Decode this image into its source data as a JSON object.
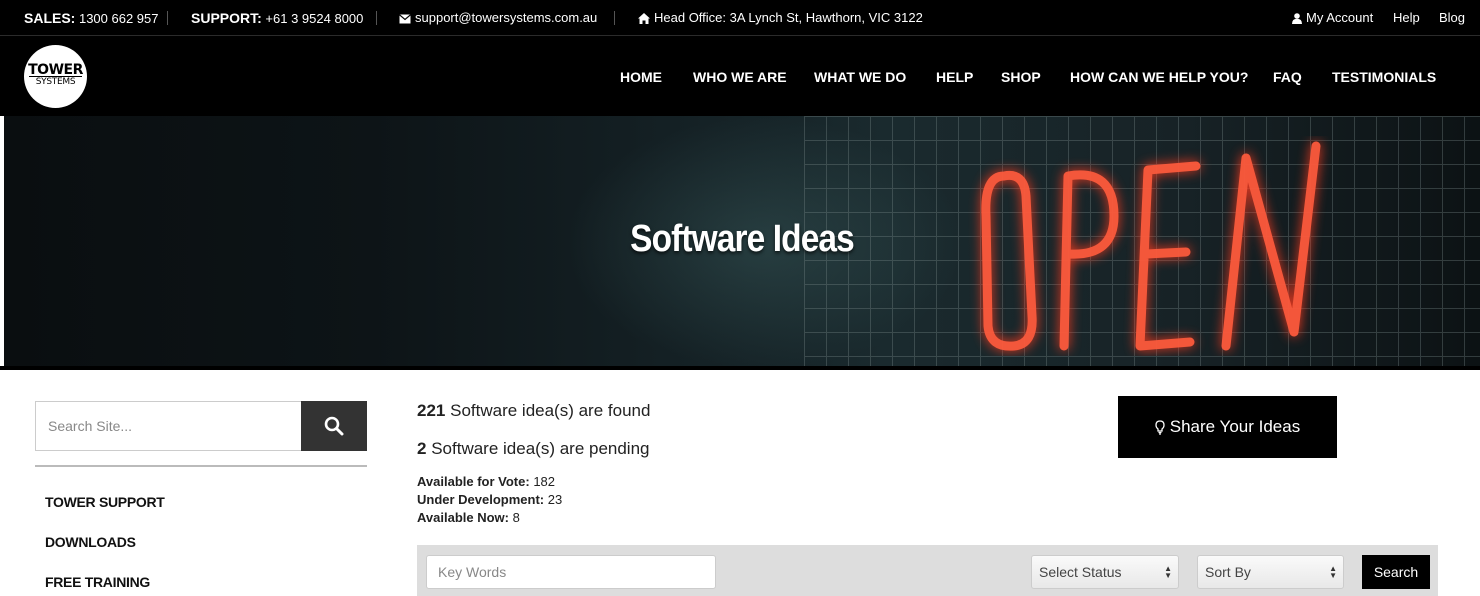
{
  "topbar": {
    "sales_label": "SALES:",
    "sales_phone": "1300 662 957",
    "support_label": "SUPPORT:",
    "support_phone": "+61 3 9524 8000",
    "email": "support@towersystems.com.au",
    "head_office": "Head Office: 3A Lynch St, Hawthorn, VIC 3122",
    "my_account": "My Account",
    "help": "Help",
    "blog": "Blog"
  },
  "logo": {
    "line1": "TOWER",
    "line2": "SYSTEMS"
  },
  "nav": {
    "items": [
      {
        "label": "HOME"
      },
      {
        "label": "WHO WE ARE"
      },
      {
        "label": "WHAT WE DO"
      },
      {
        "label": "HELP"
      },
      {
        "label": "SHOP"
      },
      {
        "label": "HOW CAN WE HELP YOU?"
      },
      {
        "label": "FAQ"
      },
      {
        "label": "TESTIMONIALS"
      }
    ]
  },
  "hero": {
    "title": "Software Ideas"
  },
  "sidebar": {
    "search_placeholder": "Search Site...",
    "links": [
      {
        "label": "TOWER SUPPORT"
      },
      {
        "label": "DOWNLOADS"
      },
      {
        "label": "FREE TRAINING"
      }
    ]
  },
  "stats": {
    "found_count": "221",
    "found_text": "Software idea(s) are found",
    "pending_count": "2",
    "pending_text": "Software idea(s) are pending",
    "vote_label": "Available for Vote:",
    "vote_value": "182",
    "dev_label": "Under Development:",
    "dev_value": "23",
    "now_label": "Available Now:",
    "now_value": "8"
  },
  "share_button": {
    "label": "Share Your Ideas"
  },
  "filters": {
    "keywords_placeholder": "Key Words",
    "status_selected": "Select Status",
    "sort_selected": "Sort By",
    "search_label": "Search"
  }
}
